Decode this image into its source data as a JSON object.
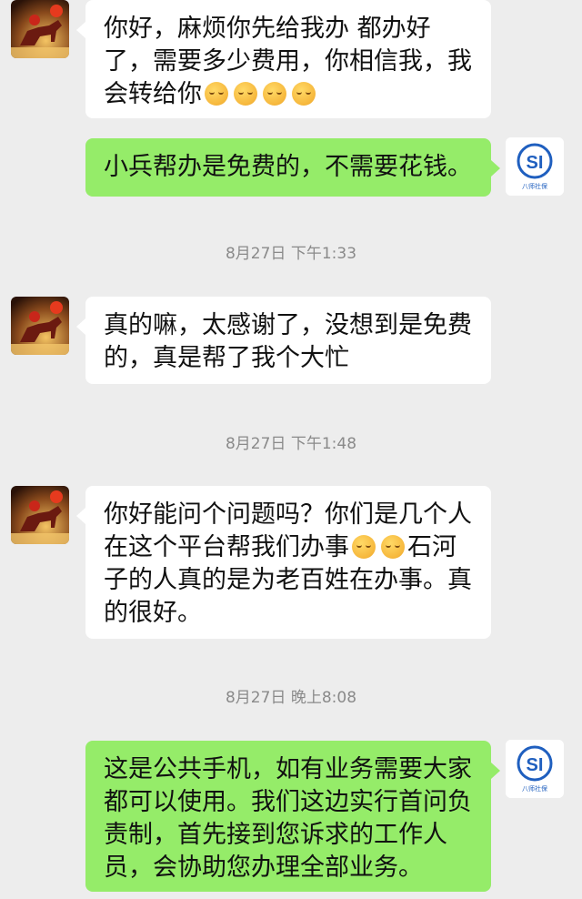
{
  "messages": [
    {
      "id": "m1",
      "side": "left",
      "text_parts": [
        "你好，麻烦你先给我办 都办好了，需要多少费用，你相信我，我会转给你"
      ],
      "emoji_count": 4,
      "emoji_name": "blushing-face-icon"
    },
    {
      "id": "m2",
      "side": "right",
      "text": "小兵帮办是免费的，不需要花钱。"
    },
    {
      "id": "t1",
      "type": "time",
      "text": "8月27日 下午1:33"
    },
    {
      "id": "m3",
      "side": "left",
      "text": "真的嘛，太感谢了，没想到是免费的，真是帮了我个大忙"
    },
    {
      "id": "t2",
      "type": "time",
      "text": "8月27日 下午1:48"
    },
    {
      "id": "m4",
      "side": "left",
      "text_parts": [
        "你好能问个问题吗？你们是几个人在这个平台帮我们办事",
        "石河子的人真的是为老百姓在办事。真的很好。"
      ],
      "emoji_count": 2,
      "emoji_name": "blushing-face-icon"
    },
    {
      "id": "t3",
      "type": "time",
      "text": "8月27日 晚上8:08"
    },
    {
      "id": "m5",
      "side": "right",
      "text": "这是公共手机，如有业务需要大家都可以使用。我们这边实行首问负责制，首先接到您诉求的工作人员，会协助您办理全部业务。"
    }
  ],
  "avatars": {
    "left_icon": "horse-rider-avatar-icon",
    "right_logo_text": "SI",
    "right_sub_text": "八师社保"
  },
  "colors": {
    "background": "#ededed",
    "incoming_bubble": "#ffffff",
    "outgoing_bubble": "#95ec69",
    "logo_blue": "#1f5fbf"
  }
}
